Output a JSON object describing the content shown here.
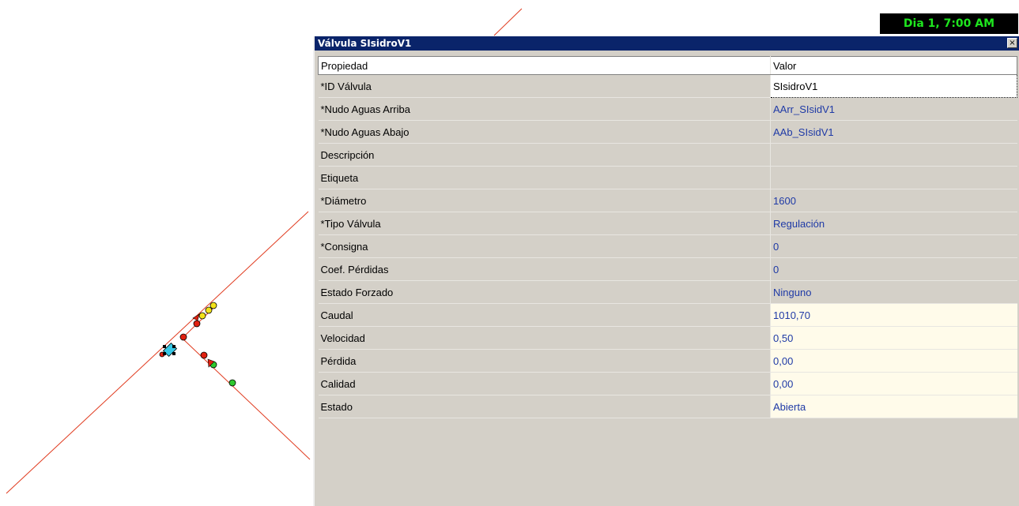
{
  "clock": "Dia 1, 7:00 AM",
  "panel": {
    "title": "Válvula SIsidroV1",
    "close_label": "×",
    "headers": {
      "property": "Propiedad",
      "value": "Valor"
    },
    "rows": [
      {
        "property": "*ID Válvula",
        "value": "SIsidroV1"
      },
      {
        "property": "*Nudo Aguas Arriba",
        "value": "AArr_SIsidV1"
      },
      {
        "property": "*Nudo Aguas Abajo",
        "value": "AAb_SIsidV1"
      },
      {
        "property": "Descripción",
        "value": ""
      },
      {
        "property": "Etiqueta",
        "value": ""
      },
      {
        "property": "*Diámetro",
        "value": "1600"
      },
      {
        "property": "*Tipo Válvula",
        "value": "Regulación"
      },
      {
        "property": "*Consigna",
        "value": "0"
      },
      {
        "property": "Coef. Pérdidas",
        "value": "0"
      },
      {
        "property": "Estado Forzado",
        "value": "Ninguno"
      },
      {
        "property": "Caudal",
        "value": "1010,70"
      },
      {
        "property": "Velocidad",
        "value": "0,50"
      },
      {
        "property": "Pérdida",
        "value": "0,00"
      },
      {
        "property": "Calidad",
        "value": "0,00"
      },
      {
        "property": "Estado",
        "value": "Abierta"
      }
    ]
  },
  "colors": {
    "pipe": "#e03a1e",
    "node_red": "#e02010",
    "node_yellow": "#f2e21a",
    "node_green": "#2ec82e",
    "valve": "#36c8e6"
  }
}
